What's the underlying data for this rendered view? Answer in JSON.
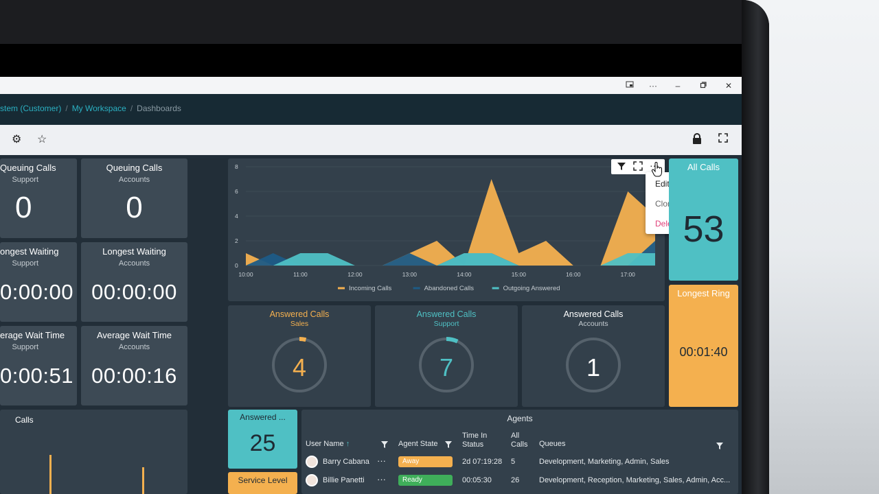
{
  "window": {
    "controls": [
      "cast-icon",
      "more-icon",
      "minimize-icon",
      "restore-icon",
      "close-icon"
    ]
  },
  "breadcrumb": {
    "items": [
      "stem (Customer)",
      "My Workspace",
      "Dashboards"
    ]
  },
  "tiles": {
    "queuing_support": {
      "title": "Queuing Calls",
      "sub": "Support",
      "value": "0"
    },
    "queuing_accounts": {
      "title": "Queuing Calls",
      "sub": "Accounts",
      "value": "0"
    },
    "longest_support": {
      "title": "ongest Waiting",
      "sub": "Support",
      "value": "0:00:00"
    },
    "longest_accounts": {
      "title": "Longest Waiting",
      "sub": "Accounts",
      "value": "00:00:00"
    },
    "avg_support": {
      "title": "erage Wait Time",
      "sub": "Support",
      "value": "0:00:51"
    },
    "avg_accounts": {
      "title": "Average Wait Time",
      "sub": "Accounts",
      "value": "00:00:16"
    },
    "calls_panel": {
      "title": "Calls"
    },
    "all_calls": {
      "title": "All Calls",
      "value": "53"
    },
    "longest_ring": {
      "title": "Longest Ring",
      "value": "00:01:40"
    },
    "answered_small": {
      "title": "Answered ...",
      "value": "25"
    },
    "service_level": {
      "title": "Service Level"
    }
  },
  "gauges": [
    {
      "title": "Answered Calls",
      "sub": "Sales",
      "value": "4",
      "color": "#f4b04f",
      "fraction": 0.04
    },
    {
      "title": "Answered Calls",
      "sub": "Support",
      "value": "7",
      "color": "#4fc0c4",
      "fraction": 0.07
    },
    {
      "title": "Answered Calls",
      "sub": "Accounts",
      "value": "1",
      "color": "#ffffff",
      "fraction": 0.0
    }
  ],
  "context_menu": {
    "items": [
      "Edit",
      "Clone",
      "Delete"
    ]
  },
  "chart_data": {
    "type": "area",
    "x": [
      "10:00",
      "10:30",
      "11:00",
      "11:30",
      "12:00",
      "12:30",
      "13:00",
      "13:30",
      "14:00",
      "14:30",
      "15:00",
      "15:30",
      "16:00",
      "16:30",
      "17:00",
      "17:15"
    ],
    "x_tick_labels": [
      "10:00",
      "11:00",
      "12:00",
      "13:00",
      "14:00",
      "15:00",
      "16:00",
      "17:00"
    ],
    "ylim": [
      0,
      8
    ],
    "y_ticks": [
      "0",
      "2",
      "4",
      "6",
      "8"
    ],
    "series": [
      {
        "name": "Incoming Calls",
        "color": "#f4b04f",
        "values": [
          1,
          0,
          0,
          0,
          0,
          0,
          1,
          2,
          0,
          7,
          1,
          2,
          0,
          0,
          6,
          4
        ]
      },
      {
        "name": "Abandoned Calls",
        "color": "#1e5b86",
        "values": [
          0,
          1,
          0,
          0,
          0,
          0,
          1,
          0,
          1,
          1,
          0,
          0,
          0,
          0,
          0,
          2
        ]
      },
      {
        "name": "Outgoing Answered",
        "color": "#4fc0c4",
        "values": [
          0,
          0,
          1,
          1,
          0,
          0,
          0,
          0,
          1,
          1,
          0,
          0,
          0,
          0,
          1,
          1
        ]
      }
    ],
    "legend": "bottom",
    "grid": true
  },
  "agents": {
    "title": "Agents",
    "columns": [
      "User Name",
      "Agent State",
      "Time In Status",
      "All Calls",
      "Queues"
    ],
    "rows": [
      {
        "name": "Barry Cabana",
        "state": "Away",
        "state_color": "#f4b04f",
        "time": "2d 07:19:28",
        "calls": "5",
        "queues": "Development, Marketing, Admin, Sales"
      },
      {
        "name": "Billie Panetti",
        "state": "Ready",
        "state_color": "#3fae5a",
        "time": "00:05:30",
        "calls": "26",
        "queues": "Development, Reception, Marketing, Sales, Admin, Acc..."
      }
    ]
  }
}
